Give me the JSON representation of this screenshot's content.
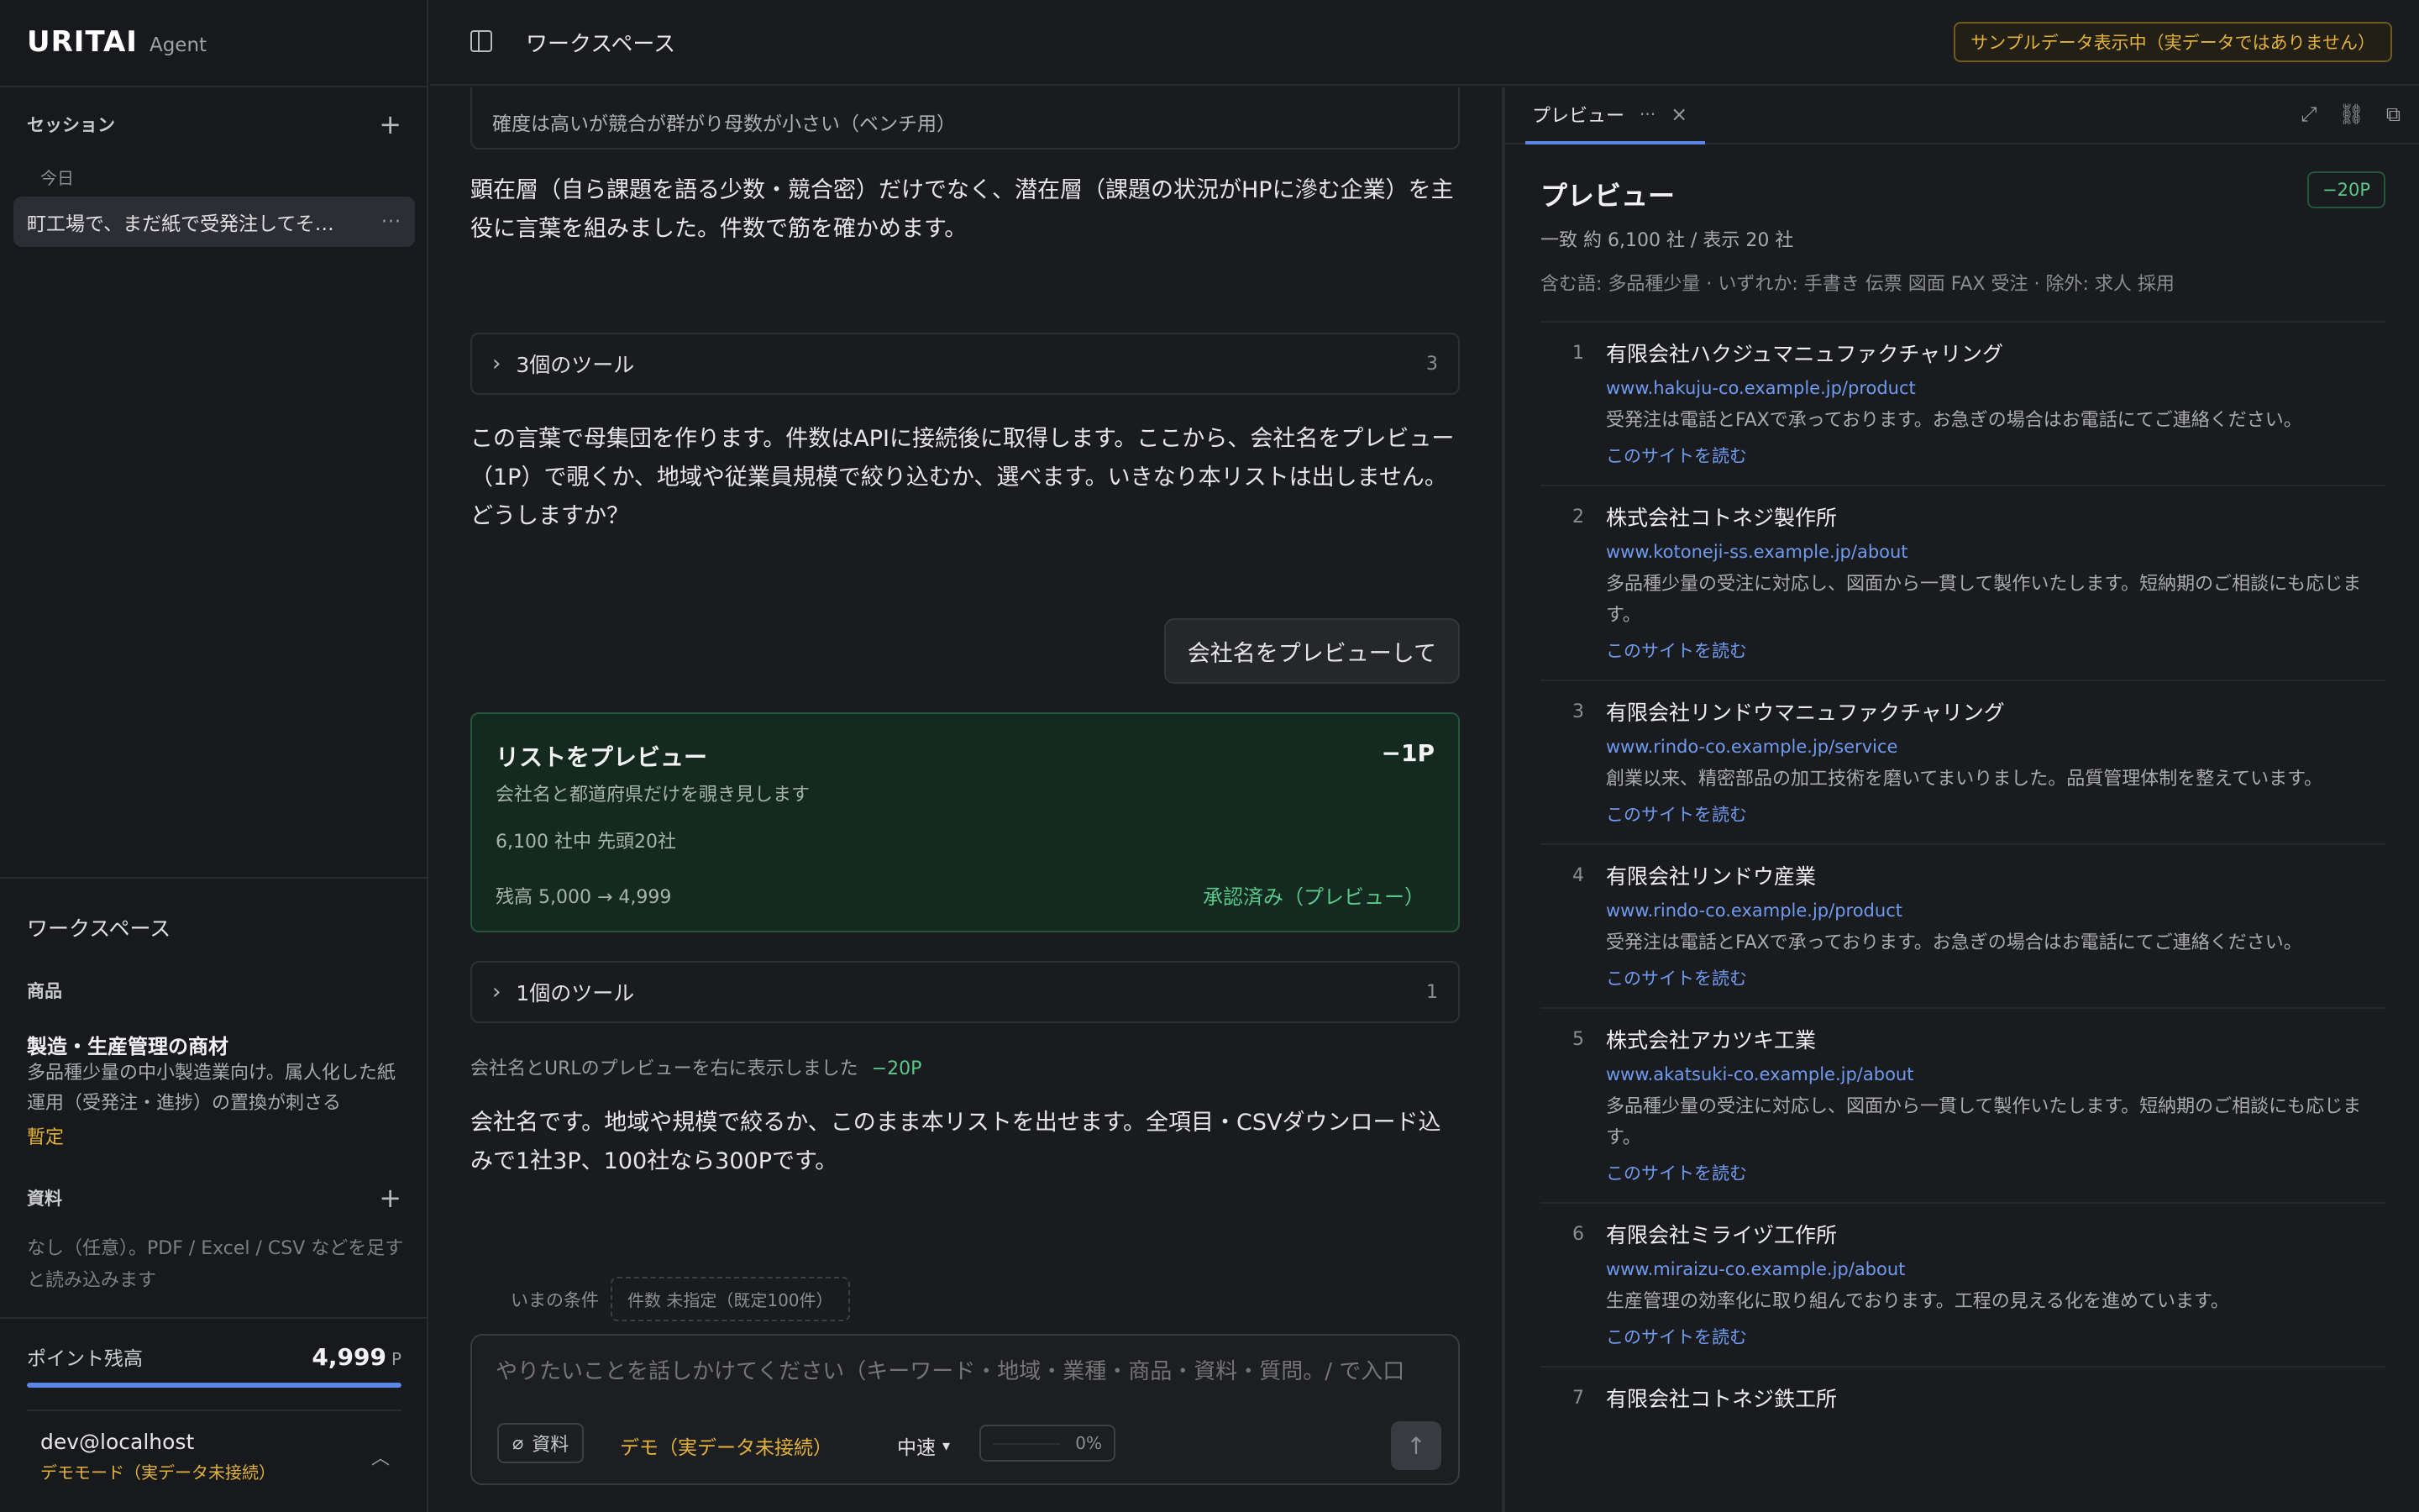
{
  "sidebar": {
    "brand": "URITAI",
    "brand_sub": "Agent",
    "sessions_title": "セッション",
    "today_label": "今日",
    "session_item": "町工場で、まだ紙で受発注してそ…",
    "workspace_label": "ワークスペース",
    "product_head": "商品",
    "product_name": "製造・生産管理の商材",
    "product_desc": "多品種少量の中小製造業向け。属人化した紙運用（受発注・進捗）の置換が刺さる",
    "product_status": "暫定",
    "materials_head": "資料",
    "materials_desc": "なし（任意）。PDF / Excel / CSV などを足すと読み込みます",
    "points_label": "ポイント残高",
    "points_value": "4,999",
    "points_unit": "P",
    "points_fill_fraction": 0.9998,
    "user_name": "dev@localhost",
    "user_mode": "デモモード（実データ未接続）"
  },
  "topbar": {
    "title": "ワークスペース",
    "sample_badge": "サンプルデータ表示中（実データではありません）"
  },
  "chat": {
    "prev_card_text": "確度は高いが競合が群がり母数が小さい（ベンチ用）",
    "msg1": "顕在層（自ら課題を語る少数・競合密）だけでなく、潜在層（課題の状況がHPに滲む企業）を主役に言葉を組みました。件数で筋を確かめます。",
    "tool1_label": "3個のツール",
    "tool1_count": "3",
    "msg2": "この言葉で母集団を作ります。件数はAPIに接続後に取得します。ここから、会社名をプレビュー（1P）で覗くか、地域や従業員規模で絞り込むか、選べます。いきなり本リストは出しません。どうしますか？",
    "user_msg": "会社名をプレビューして",
    "approve": {
      "title": "リストをプレビュー",
      "cost": "−1P",
      "sub": "会社名と都道府県だけを覗き見します",
      "meta": "6,100 社中 先頭20社",
      "balance": "残高 5,000 → 4,999",
      "status": "承認済み（プレビュー）"
    },
    "tool2_label": "1個のツール",
    "tool2_count": "1",
    "note": "会社名とURLのプレビューを右に表示しました",
    "note_cost": "−20P",
    "msg3": "会社名です。地域や規模で絞るか、このまま本リストを出せます。全項目・CSVダウンロード込みで1社3P、100社なら300Pです。",
    "cond_label": "いまの条件",
    "cond_chip": "件数 未指定（既定100件）",
    "placeholder": "やりたいことを話しかけてください（キーワード・地域・業種・商品・資料・質問。/ で入口",
    "attach_label": "資料",
    "demo_label": "デモ（実データ未接続）",
    "speed_label": "中速",
    "ctx_percent": "0%"
  },
  "preview": {
    "tab_label": "プレビュー",
    "title": "プレビュー",
    "badge": "−20P",
    "count": "一致 約 6,100 社 / 表示 20 社",
    "filter": "含む語: 多品種少量 · いずれか: 手書き 伝票 図面 FAX 受注 · 除外: 求人 採用",
    "read_link": "このサイトを読む",
    "items": [
      {
        "num": "1",
        "name": "有限会社ハクジュマニュファクチャリング",
        "url": "www.hakuju-co.example.jp/product",
        "desc": "受発注は電話とFAXで承っております。お急ぎの場合はお電話にてご連絡ください。"
      },
      {
        "num": "2",
        "name": "株式会社コトネジ製作所",
        "url": "www.kotoneji-ss.example.jp/about",
        "desc": "多品種少量の受注に対応し、図面から一貫して製作いたします。短納期のご相談にも応じます。"
      },
      {
        "num": "3",
        "name": "有限会社リンドウマニュファクチャリング",
        "url": "www.rindo-co.example.jp/service",
        "desc": "創業以来、精密部品の加工技術を磨いてまいりました。品質管理体制を整えています。"
      },
      {
        "num": "4",
        "name": "有限会社リンドウ産業",
        "url": "www.rindo-co.example.jp/product",
        "desc": "受発注は電話とFAXで承っております。お急ぎの場合はお電話にてご連絡ください。"
      },
      {
        "num": "5",
        "name": "株式会社アカツキ工業",
        "url": "www.akatsuki-co.example.jp/about",
        "desc": "多品種少量の受注に対応し、図面から一貫して製作いたします。短納期のご相談にも応じます。"
      },
      {
        "num": "6",
        "name": "有限会社ミライヅ工作所",
        "url": "www.miraizu-co.example.jp/about",
        "desc": "生産管理の効率化に取り組んでおります。工程の見える化を進めています。"
      },
      {
        "num": "7",
        "name": "有限会社コトネジ鉄工所",
        "url": "",
        "desc": ""
      }
    ]
  },
  "colors": {
    "accent_blue": "#5b86e5",
    "success_green": "#5ac98a",
    "warning_amber": "#e2b23a"
  }
}
